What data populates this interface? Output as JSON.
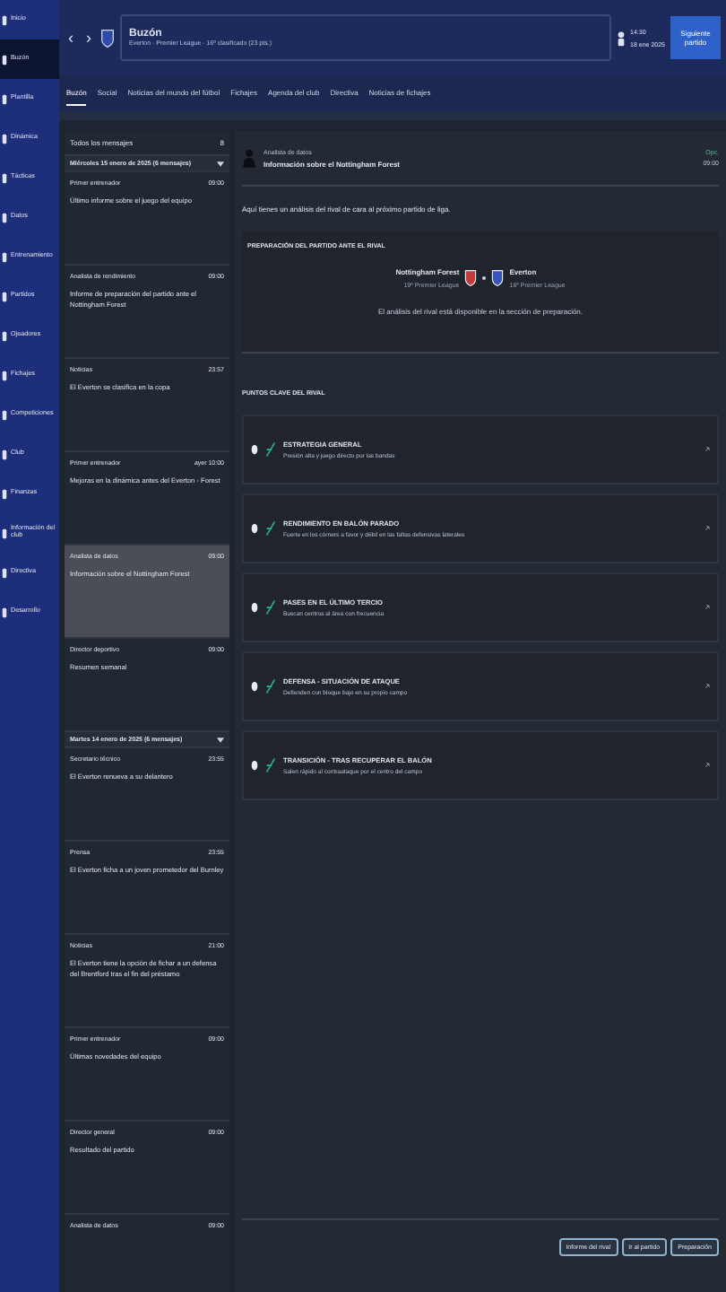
{
  "sidebar": {
    "items": [
      {
        "label": "Inicio",
        "selected": false
      },
      {
        "label": "Buzón",
        "selected": true
      },
      {
        "label": "Plantilla",
        "selected": false
      },
      {
        "label": "Dinámica",
        "selected": false
      },
      {
        "label": "Tácticas",
        "selected": false
      },
      {
        "label": "Datos",
        "selected": false
      },
      {
        "label": "Entrenamiento",
        "selected": false
      },
      {
        "label": "Partidos",
        "selected": false
      },
      {
        "label": "Ojeadores",
        "selected": false
      },
      {
        "label": "Fichajes",
        "selected": false
      },
      {
        "label": "Competiciones",
        "selected": false
      },
      {
        "label": "Club",
        "selected": false
      },
      {
        "label": "Finanzas",
        "selected": false
      },
      {
        "label": "Información del club",
        "selected": false
      },
      {
        "label": "Directiva",
        "selected": false
      },
      {
        "label": "Desarrollo",
        "selected": false
      }
    ]
  },
  "header": {
    "back": "‹",
    "forward": "›",
    "title": "Buzón",
    "subtitle": "Everton · Premier League · 16º clasificado (23 pts.)",
    "time": "14:30",
    "date": "18 ene 2025",
    "continue": "Siguiente partido"
  },
  "tabs": [
    {
      "label": "Buzón",
      "selected": true
    },
    {
      "label": "Social",
      "selected": false
    },
    {
      "label": "Noticias del mundo del fútbol",
      "selected": false
    },
    {
      "label": "Fichajes",
      "selected": false
    },
    {
      "label": "Agenda del club",
      "selected": false
    },
    {
      "label": "Directiva",
      "selected": false
    },
    {
      "label": "Noticias de fichajes",
      "selected": false
    }
  ],
  "inbox": {
    "filter": "Todos los mensajes",
    "count": "8",
    "groups": [
      {
        "title": "Miércoles 15 enero de 2025 (6 mensajes)",
        "expanded": true,
        "messages": [
          {
            "sender": "Primer entrenador",
            "time": "09:00",
            "subject": "Último informe sobre el juego del equipo",
            "selected": false
          },
          {
            "sender": "Analista de rendimiento",
            "time": "09:00",
            "subject": "Informe de preparación del partido ante el Nottingham Forest",
            "selected": false
          },
          {
            "sender": "Noticias",
            "time": "23:57",
            "subject": "El Everton se clasifica en la copa",
            "selected": false
          },
          {
            "sender": "Primer entrenador",
            "time": "ayer 10:00",
            "subject": "Mejoras en la dinámica antes del Everton - Forest",
            "selected": false
          },
          {
            "sender": "Analista de datos",
            "time": "09:00",
            "subject": "Información sobre el Nottingham Forest",
            "selected": true
          },
          {
            "sender": "Director deportivo",
            "time": "09:00",
            "subject": "Resumen semanal",
            "selected": false
          }
        ]
      },
      {
        "title": "Martes 14 enero de 2025 (6 mensajes)",
        "expanded": true,
        "messages": [
          {
            "sender": "Secretario técnico",
            "time": "23:55",
            "subject": "El Everton renueva a su delantero",
            "selected": false
          },
          {
            "sender": "Prensa",
            "time": "23:55",
            "subject": "El Everton ficha a un joven prometedor del Burnley",
            "selected": false
          },
          {
            "sender": "Noticias",
            "time": "21:00",
            "subject": "El Everton tiene la opción de fichar a un defensa del Brentford tras el fin del préstamo",
            "selected": false
          },
          {
            "sender": "Primer entrenador",
            "time": "09:00",
            "subject": "Últimas novedades del equipo",
            "selected": false
          },
          {
            "sender": "Director general",
            "time": "09:00",
            "subject": "Resultado del partido",
            "selected": false
          },
          {
            "sender": "Analista de datos",
            "time": "09:00",
            "selected": false
          }
        ]
      }
    ]
  },
  "message": {
    "sender": "Analista de datos",
    "subject": "Información sobre el Nottingham Forest",
    "options": "Opc.",
    "time": "09:00",
    "intro": "Aquí tienes un análisis del rival de cara al próximo partido de liga.",
    "preview": {
      "title": "PREPARACIÓN DEL PARTIDO ANTE EL RIVAL",
      "home": {
        "name": "Nottingham Forest",
        "position": "19º Premier League"
      },
      "away": {
        "name": "Everton",
        "position": "16º Premier League"
      },
      "note": "El análisis del rival está disponible en la sección de preparación."
    },
    "key_points_title": "PUNTOS CLAVE DEL RIVAL",
    "key_points": [
      {
        "title": "ESTRATEGIA GENERAL",
        "text": "Presión alta y juego directo por las bandas"
      },
      {
        "title": "RENDIMIENTO EN BALÓN PARADO",
        "text": "Fuerte en los córners a favor y débil en las faltas defensivas laterales"
      },
      {
        "title": "PASES EN EL ÚLTIMO TERCIO",
        "text": "Buscan centros al área con frecuencia"
      },
      {
        "title": "DEFENSA - SITUACIÓN DE ATAQUE",
        "text": "Defienden con bloque bajo en su propio campo"
      },
      {
        "title": "TRANSICIÓN - TRAS RECUPERAR EL BALÓN",
        "text": "Salen rápido al contraataque por el centro del campo"
      }
    ],
    "buttons": [
      "Informe del rival",
      "Ir al partido",
      "Preparación"
    ]
  }
}
